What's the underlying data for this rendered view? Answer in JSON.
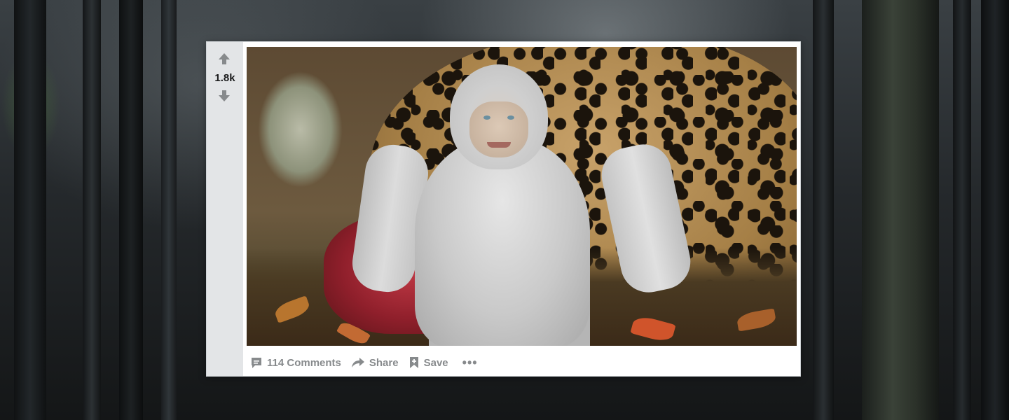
{
  "post": {
    "vote_count": "1.8k",
    "actions": {
      "comments_label": "114 Comments",
      "share_label": "Share",
      "save_label": "Save",
      "more_label": "•••"
    }
  },
  "icons": {
    "upvote": "arrow-up-icon",
    "downvote": "arrow-down-icon",
    "comments": "comment-icon",
    "share": "share-icon",
    "save": "bookmark-icon",
    "more": "more-icon"
  },
  "colors": {
    "card_bg": "#ffffff",
    "vote_bar_bg": "#e3e5e7",
    "vote_text": "#1a1a1b",
    "action_text": "#878a8c",
    "icon_gray": "#878a8c"
  }
}
